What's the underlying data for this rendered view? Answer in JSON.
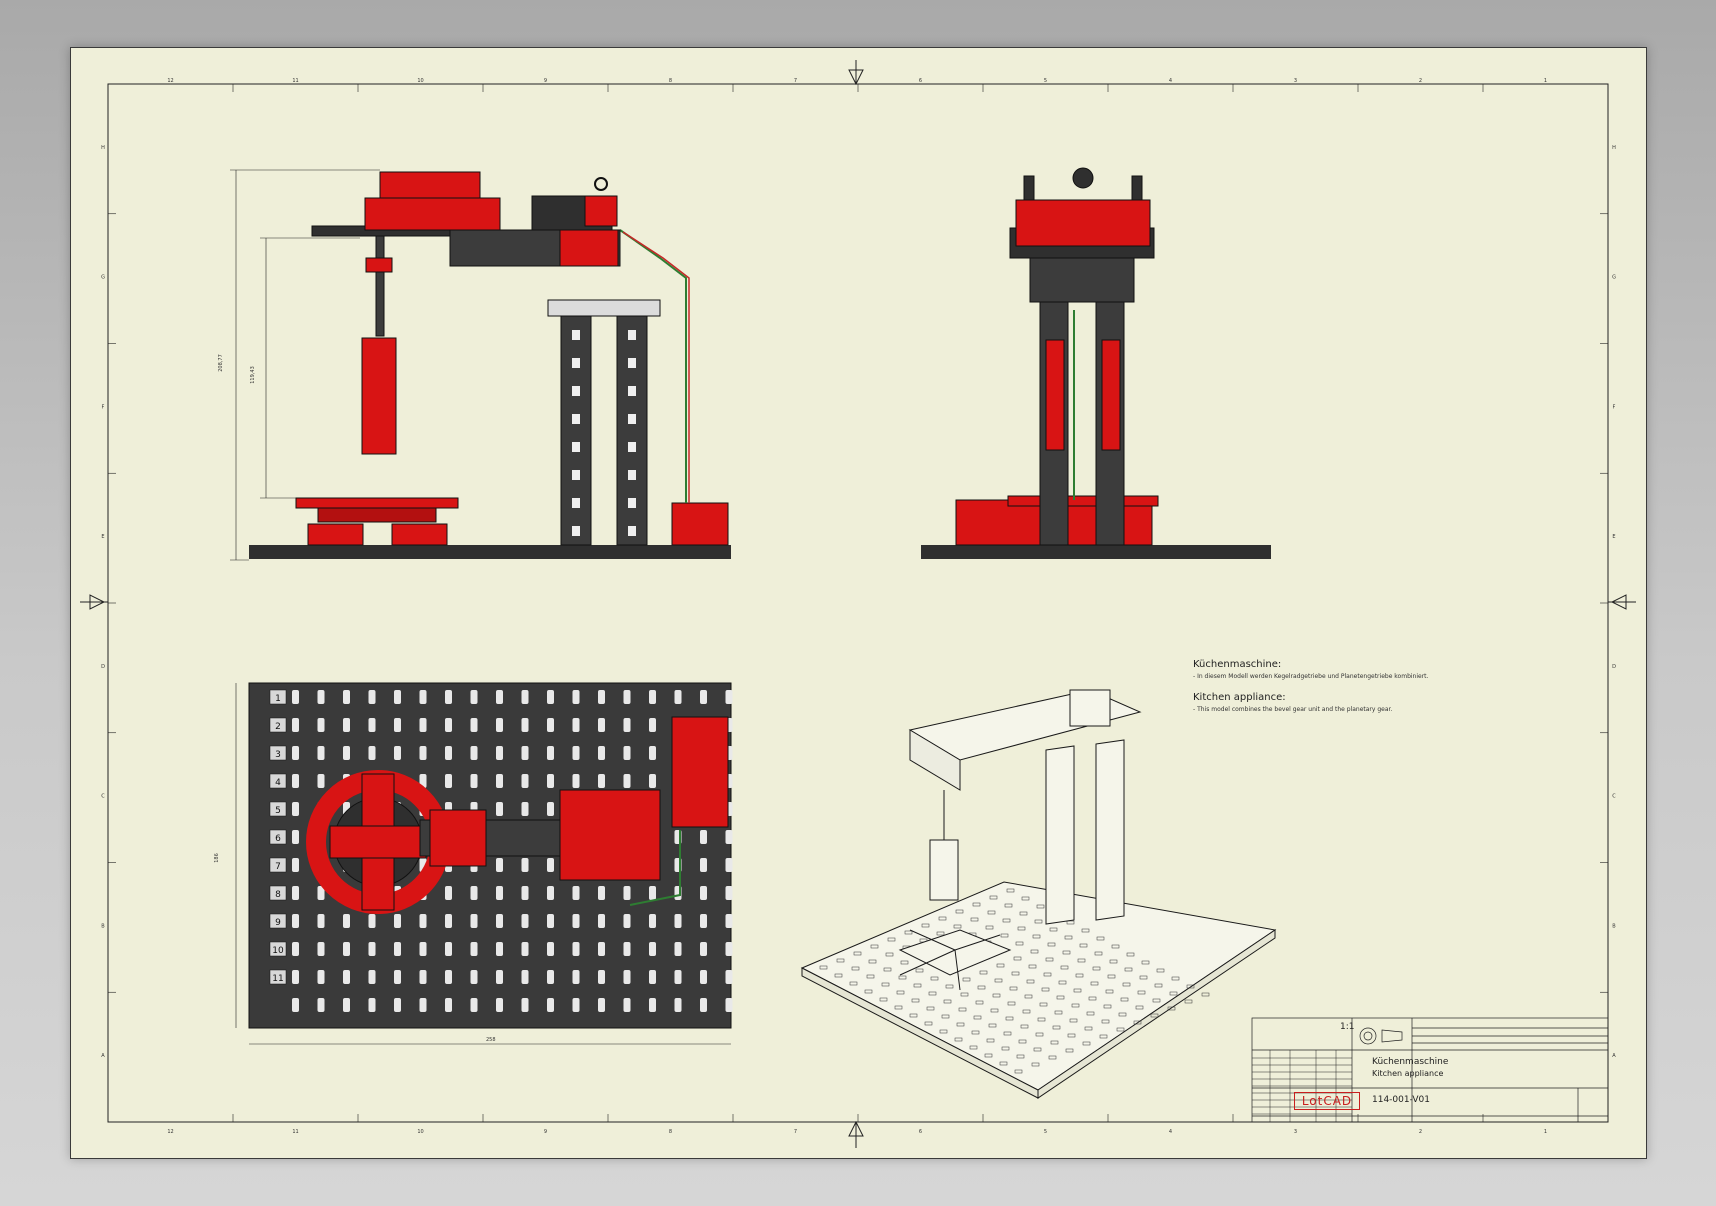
{
  "notes": {
    "title_de": "Küchenmaschine:",
    "text_de": "- In diesem Modell werden Kegelradgetriebe und Planetengetriebe kombiniert.",
    "title_en": "Kitchen appliance:",
    "text_en": "- This model combines the bevel gear unit and the planetary gear."
  },
  "title_block": {
    "title_de": "Küchenmaschine",
    "title_en": "Kitchen appliance",
    "drawing_number": "114-001-V01",
    "scale": "1:1",
    "logo": "LotCAD"
  },
  "dimensions": {
    "side_total_height": "208,77",
    "side_arm_height": "119,43",
    "top_width": "258",
    "top_height": "186"
  },
  "row_numbers": [
    "1",
    "2",
    "3",
    "4",
    "5",
    "6",
    "7",
    "8",
    "9",
    "10",
    "11"
  ],
  "border_letters": [
    "H",
    "G",
    "F",
    "E",
    "D",
    "C",
    "B",
    "A"
  ],
  "border_numbers": [
    "12",
    "11",
    "10",
    "9",
    "8",
    "7",
    "6",
    "5",
    "4",
    "3",
    "2",
    "1"
  ],
  "colors": {
    "sheet": "#efefd9",
    "part_red": "#d81414",
    "part_dark": "#3c3c3c",
    "base_plate": "#2f2f2f",
    "line": "#1a1a1a"
  }
}
